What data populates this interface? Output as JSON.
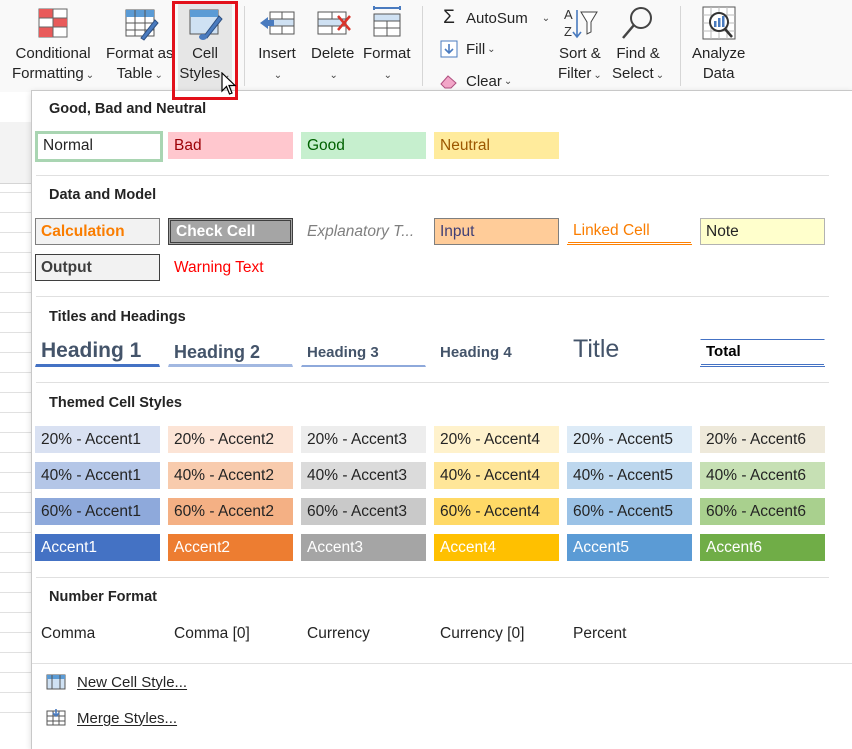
{
  "ribbon": {
    "conditional_formatting": {
      "line1": "Conditional",
      "line2": "Formatting"
    },
    "format_as_table": {
      "line1": "Format as",
      "line2": "Table"
    },
    "cell_styles": {
      "line1": "Cell",
      "line2": "Styles"
    },
    "insert": "Insert",
    "delete": "Delete",
    "format": "Format",
    "autosum": "AutoSum",
    "fill": "Fill",
    "clear": "Clear",
    "sort_filter": {
      "line1": "Sort &",
      "line2": "Filter"
    },
    "find_select": {
      "line1": "Find &",
      "line2": "Select"
    },
    "analyze_data": {
      "line1": "Analyze",
      "line2": "Data"
    },
    "chevron": "⌄"
  },
  "gallery": {
    "sections": {
      "good_bad_neutral": "Good, Bad and Neutral",
      "data_model": "Data and Model",
      "titles_headings": "Titles and Headings",
      "themed": "Themed Cell Styles",
      "number_format": "Number Format"
    },
    "good_bad_neutral": [
      "Normal",
      "Bad",
      "Good",
      "Neutral"
    ],
    "data_model": [
      "Calculation",
      "Check Cell",
      "Explanatory T...",
      "Input",
      "Linked Cell",
      "Note",
      "Output",
      "Warning Text"
    ],
    "titles": [
      "Heading 1",
      "Heading 2",
      "Heading 3",
      "Heading 4",
      "Title",
      "Total"
    ],
    "themed": {
      "row20": [
        "20% - Accent1",
        "20% - Accent2",
        "20% - Accent3",
        "20% - Accent4",
        "20% - Accent5",
        "20% - Accent6"
      ],
      "row40": [
        "40% - Accent1",
        "40% - Accent2",
        "40% - Accent3",
        "40% - Accent4",
        "40% - Accent5",
        "40% - Accent6"
      ],
      "row60": [
        "60% - Accent1",
        "60% - Accent2",
        "60% - Accent3",
        "60% - Accent4",
        "60% - Accent5",
        "60% - Accent6"
      ],
      "accent": [
        "Accent1",
        "Accent2",
        "Accent3",
        "Accent4",
        "Accent5",
        "Accent6"
      ]
    },
    "number_format": [
      "Comma",
      "Comma [0]",
      "Currency",
      "Currency [0]",
      "Percent"
    ],
    "menu": {
      "new_cell_style": "New Cell Style...",
      "merge_styles": "Merge Styles..."
    }
  },
  "colors": {
    "highlight_red": "#e2101a",
    "accent1": "#4472c4",
    "accent2": "#ed7d31",
    "accent3": "#a5a5a5",
    "accent4": "#ffc000",
    "accent5": "#5b9bd5",
    "accent6": "#70ad47"
  }
}
